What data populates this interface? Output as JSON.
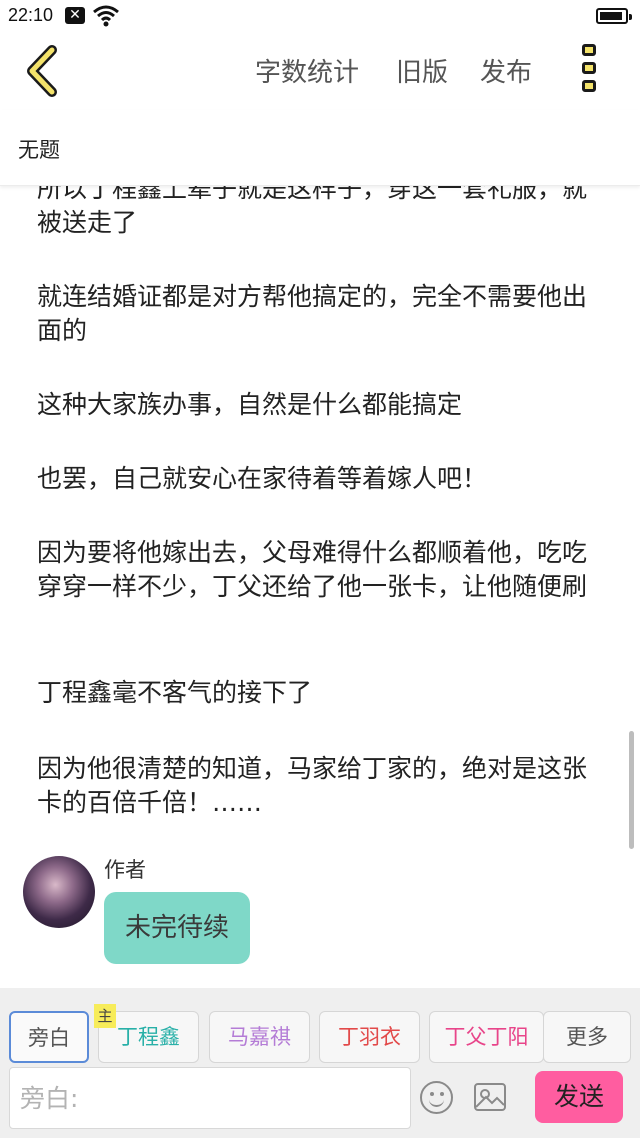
{
  "status_bar": {
    "time": "22:10",
    "notification_icon": "close-box-icon",
    "wifi_icon": "wifi-icon",
    "battery_icon": "battery-icon"
  },
  "toolbar": {
    "back_icon": "chevron-left-icon",
    "word_count_label": "字数统计",
    "old_version_label": "旧版",
    "publish_label": "发布",
    "more_icon": "vertical-dots-icon",
    "accent_color": "#f4e36a"
  },
  "title": "无题",
  "content": {
    "paragraphs": [
      "所以丁程鑫上辈子就是这样子，穿这一套礼服，就被送走了",
      "就连结婚证都是对方帮他搞定的，完全不需要他出面的",
      "这种大家族办事，自然是什么都能搞定",
      "也罢，自己就安心在家待着等着嫁人吧！",
      "因为要将他嫁出去，父母难得什么都顺着他，吃吃穿穿一样不少，丁父还给了他一张卡，让他随便刷",
      "丁程鑫毫不客气的接下了",
      "因为他很清楚的知道，马家给丁家的，绝对是这张卡的百倍千倍！……"
    ],
    "message": {
      "author": "作者",
      "text": "未完待续",
      "bubble_color": "#7fd8c8"
    }
  },
  "roles": {
    "aside": "旁白",
    "main_badge": "主",
    "items": [
      {
        "name": "丁程鑫",
        "color": "#29b0a8"
      },
      {
        "name": "马嘉祺",
        "color": "#b47cd6"
      },
      {
        "name": "丁羽衣",
        "color": "#e24a4a"
      },
      {
        "name": "丁父丁阳",
        "color": "#e8458a"
      }
    ],
    "more": "更多"
  },
  "composer": {
    "placeholder": "旁白:",
    "emoji_icon": "emoji-icon",
    "image_icon": "image-icon",
    "send_label": "发送",
    "send_color": "#ff5da0"
  }
}
